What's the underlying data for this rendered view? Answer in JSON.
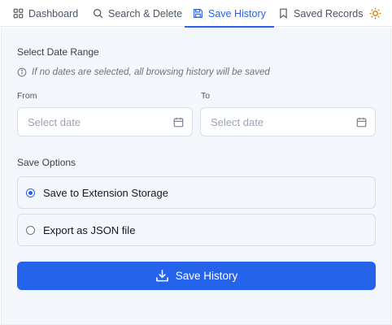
{
  "tabs": [
    {
      "label": "Dashboard",
      "icon": "grid-icon",
      "active": false
    },
    {
      "label": "Search & Delete",
      "icon": "search-icon",
      "active": false
    },
    {
      "label": "Save History",
      "icon": "save-icon",
      "active": true
    },
    {
      "label": "Saved Records",
      "icon": "bookmark-icon",
      "active": false
    }
  ],
  "theme_toggle_icon": "sun-icon",
  "date_range": {
    "title": "Select Date Range",
    "info": "If no dates are selected, all browsing history will be saved",
    "from": {
      "label": "From",
      "placeholder": "Select date",
      "value": ""
    },
    "to": {
      "label": "To",
      "placeholder": "Select date",
      "value": ""
    }
  },
  "save_options": {
    "title": "Save Options",
    "options": [
      {
        "label": "Save to Extension Storage",
        "selected": true
      },
      {
        "label": "Export as JSON file",
        "selected": false
      }
    ]
  },
  "action": {
    "label": "Save History",
    "icon": "download-icon"
  },
  "colors": {
    "accent": "#2563eb",
    "panel": "#f4f8fc"
  }
}
